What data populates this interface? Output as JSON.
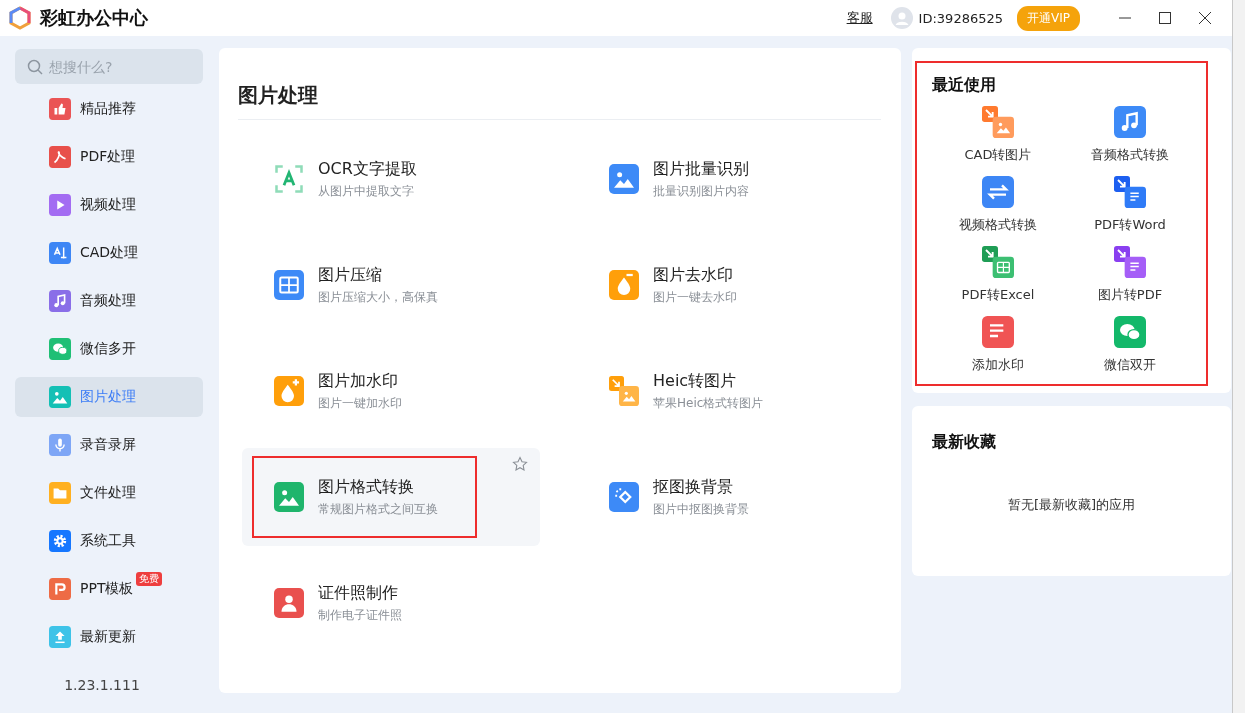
{
  "app": {
    "title": "彩虹办公中心",
    "support_link": "客服",
    "user_id": "ID:39286525",
    "vip_button": "开通VIP"
  },
  "sidebar": {
    "search_placeholder": "想搜什么?",
    "items": [
      {
        "label": "精品推荐",
        "selected": false
      },
      {
        "label": "PDF处理",
        "selected": false
      },
      {
        "label": "视频处理",
        "selected": false
      },
      {
        "label": "CAD处理",
        "selected": false
      },
      {
        "label": "音频处理",
        "selected": false
      },
      {
        "label": "微信多开",
        "selected": false
      },
      {
        "label": "图片处理",
        "selected": true
      },
      {
        "label": "录音录屏",
        "selected": false
      },
      {
        "label": "文件处理",
        "selected": false
      },
      {
        "label": "系统工具",
        "selected": false
      },
      {
        "label": "PPT模板",
        "selected": false,
        "badge": "免费"
      },
      {
        "label": "最新更新",
        "selected": false
      }
    ],
    "version": "1.23.1.111"
  },
  "main": {
    "title": "图片处理",
    "tools": [
      {
        "name": "OCR文字提取",
        "description": "从图片中提取文字",
        "hovered": false,
        "highlighted": false
      },
      {
        "name": "图片批量识别",
        "description": "批量识别图片内容",
        "hovered": false,
        "highlighted": false
      },
      {
        "name": "图片压缩",
        "description": "图片压缩大小，高保真",
        "hovered": false,
        "highlighted": false
      },
      {
        "name": "图片去水印",
        "description": "图片一键去水印",
        "hovered": false,
        "highlighted": false
      },
      {
        "name": "图片加水印",
        "description": "图片一键加水印",
        "hovered": false,
        "highlighted": false
      },
      {
        "name": "Heic转图片",
        "description": "苹果Heic格式转图片",
        "hovered": false,
        "highlighted": false
      },
      {
        "name": "图片格式转换",
        "description": "常规图片格式之间互换",
        "hovered": true,
        "highlighted": true
      },
      {
        "name": "抠图换背景",
        "description": "图片中抠图换背景",
        "hovered": false,
        "highlighted": false
      },
      {
        "name": "证件照制作",
        "description": "制作电子证件照",
        "hovered": false,
        "highlighted": false
      }
    ]
  },
  "recent": {
    "title": "最近使用",
    "highlighted": true,
    "items": [
      {
        "label": "CAD转图片"
      },
      {
        "label": "音频格式转换"
      },
      {
        "label": "视频格式转换"
      },
      {
        "label": "PDF转Word"
      },
      {
        "label": "PDF转Excel"
      },
      {
        "label": "图片转PDF"
      },
      {
        "label": "添加水印"
      },
      {
        "label": "微信双开"
      }
    ]
  },
  "favorites": {
    "title": "最新收藏",
    "empty_text": "暂无[最新收藏]的应用"
  }
}
